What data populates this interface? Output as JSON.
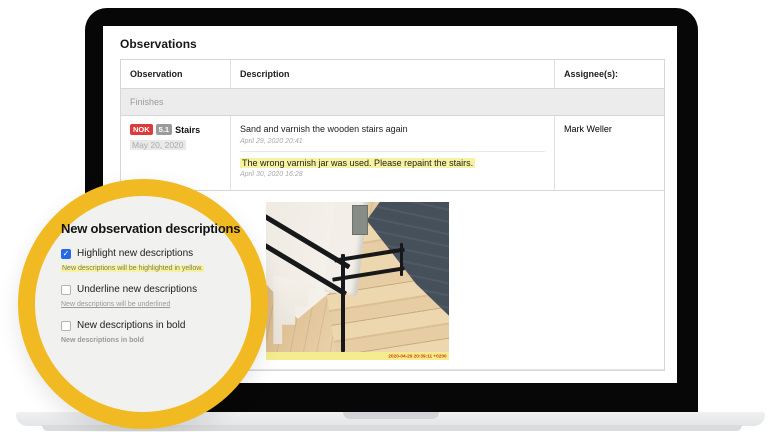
{
  "screen": {
    "title": "Observations",
    "table": {
      "headers": {
        "observation": "Observation",
        "description": "Description",
        "assignee": "Assignee(s):"
      },
      "section_label": "Finishes",
      "row": {
        "status_badge": "NOK",
        "number_badge": "5.1",
        "name": "Stairs",
        "date": "May 20, 2020",
        "assignee": "Mark Weller",
        "descriptions": [
          {
            "text": "Sand and varnish the wooden stairs again",
            "timestamp": "April 29, 2020 20:41",
            "highlighted": false
          },
          {
            "text": "The wrong varnish jar was used. Please repaint the stairs.",
            "timestamp": "April 30, 2020 16:28",
            "highlighted": true
          }
        ],
        "photo_timestamp": "2020-04-29 20:39:11 +0200"
      }
    }
  },
  "lens": {
    "title": "New observation descriptions",
    "options": [
      {
        "label": "Highlight new descriptions",
        "checked": true,
        "note": "New descriptions will be highlighted in yellow."
      },
      {
        "label": "Underline new descriptions",
        "checked": false,
        "note": "New descriptions will be underlined"
      },
      {
        "label": "New descriptions in bold",
        "checked": false,
        "note": "New descriptions in bold"
      }
    ]
  },
  "icons": {
    "check_glyph": "✓"
  },
  "colors": {
    "lens_ring": "#f2ba22",
    "highlight_yellow": "#f7f2a0",
    "badge_red": "#dd3a3a",
    "badge_gray": "#9b9b9b",
    "checkbox_blue": "#2468e5"
  }
}
